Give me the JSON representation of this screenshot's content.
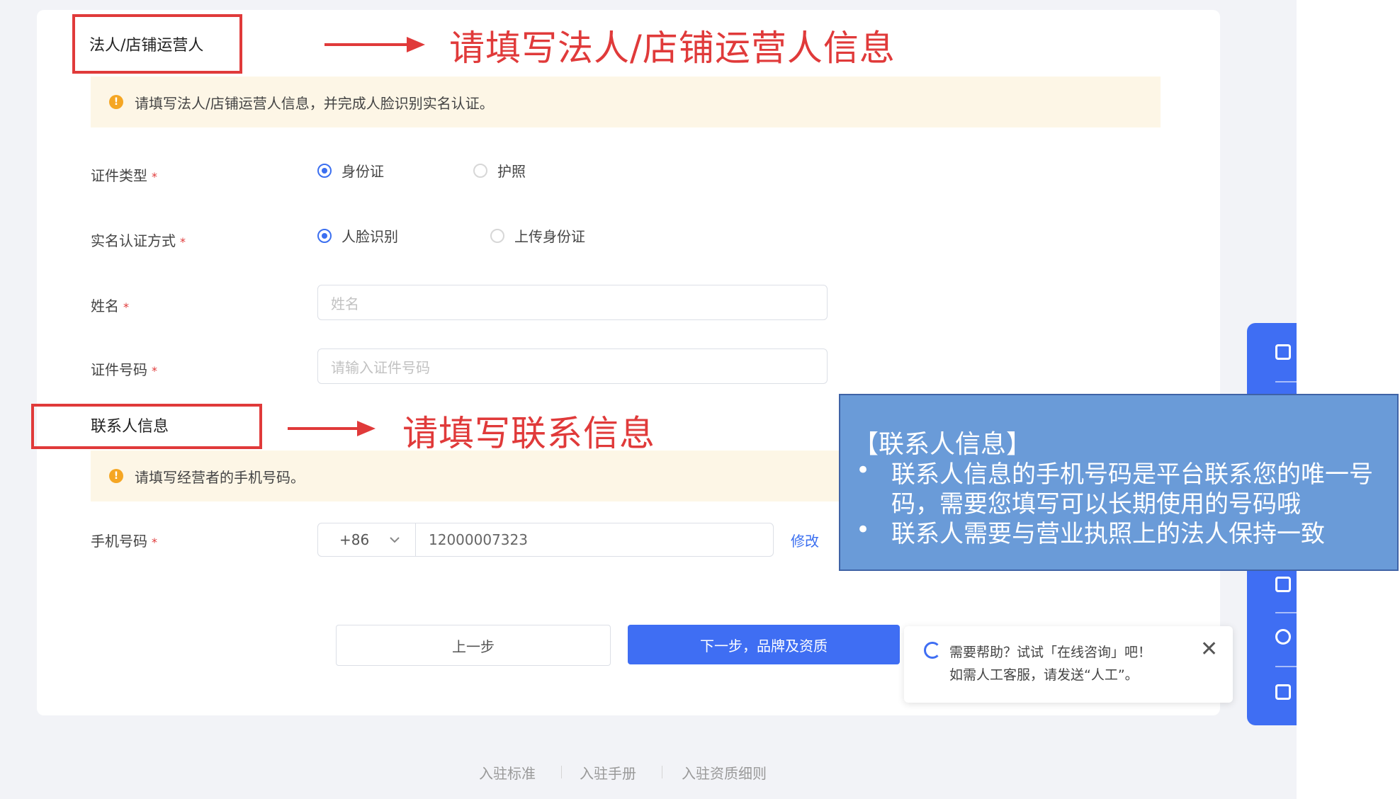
{
  "section1": {
    "title": "法人/店铺运营人",
    "annotation": "请填写法人/店铺运营人信息",
    "notice": "请填写法人/店铺运营人信息，并完成人脸识别实名认证。"
  },
  "form": {
    "cert_type": {
      "label": "证件类型",
      "options": [
        "身份证",
        "护照"
      ],
      "selected": "身份证"
    },
    "verify_method": {
      "label": "实名认证方式",
      "options": [
        "人脸识别",
        "上传身份证"
      ],
      "selected": "人脸识别"
    },
    "name": {
      "label": "姓名",
      "placeholder": "姓名"
    },
    "cert_number": {
      "label": "证件号码",
      "placeholder": "请输入证件号码"
    },
    "required_mark": "*"
  },
  "section2": {
    "title": "联系人信息",
    "annotation": "请填写联系信息",
    "notice": "请填写经营者的手机号码。",
    "phone": {
      "label": "手机号码",
      "country_code": "+86",
      "value": "12000007323",
      "modify_label": "修改"
    }
  },
  "buttons": {
    "prev": "上一步",
    "next": "下一步，品牌及资质"
  },
  "info_panel": {
    "title": "【联系人信息】",
    "bullet": "•",
    "bullet1_line1": "联系人信息的手机号码是平台联系您的唯一号",
    "bullet1_line2": "码，需要您填写可以长期使用的号码哦",
    "bullet2": "联系人需要与营业执照上的法人保持一致"
  },
  "help_popup": {
    "line1": "需要帮助？试试「在线咨询」吧！",
    "line2": "如需人工客服，请发送“人工”。",
    "close": "✕"
  },
  "footer": {
    "links": [
      "入驻标准",
      "入驻手册",
      "入驻资质细则"
    ]
  },
  "colors": {
    "accent": "#3f6ef3",
    "annotation_red": "#e03a3a",
    "notice_bg": "#fdf6e6",
    "warn": "#f5a623",
    "panel_bg": "#6a9bd8"
  }
}
